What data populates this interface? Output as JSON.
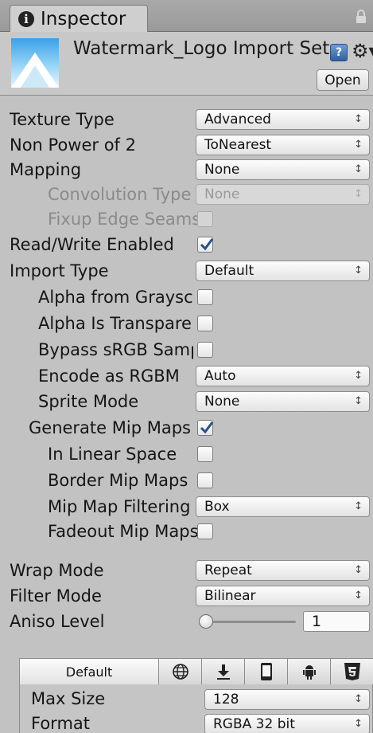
{
  "tab": {
    "title": "Inspector",
    "info_icon": "info-icon",
    "lock_icon": "lock-icon"
  },
  "header": {
    "title": "Watermark_Logo Import Settin",
    "open_label": "Open",
    "help_icon": "?",
    "gear_icon": "⚙▾"
  },
  "properties": {
    "texture_type": {
      "label": "Texture Type",
      "value": "Advanced"
    },
    "non_power_of_2": {
      "label": "Non Power of 2",
      "value": "ToNearest"
    },
    "mapping": {
      "label": "Mapping",
      "value": "None"
    },
    "convolution_type": {
      "label": "Convolution Type",
      "value": "None",
      "disabled": true
    },
    "fixup_edge_seams": {
      "label": "Fixup Edge Seams",
      "checked": false,
      "disabled": true
    },
    "read_write_enabled": {
      "label": "Read/Write Enabled",
      "checked": true
    },
    "import_type": {
      "label": "Import Type",
      "value": "Default"
    },
    "alpha_from_grayscale": {
      "label": "Alpha from Graysca",
      "checked": false
    },
    "alpha_is_transparency": {
      "label": "Alpha Is Transpare",
      "checked": false
    },
    "bypass_srgb": {
      "label": "Bypass sRGB Sampl",
      "checked": false
    },
    "encode_as_rgbm": {
      "label": "Encode as RGBM",
      "value": "Auto"
    },
    "sprite_mode": {
      "label": "Sprite Mode",
      "value": "None"
    },
    "generate_mip_maps": {
      "label": "Generate Mip Maps",
      "checked": true
    },
    "in_linear_space": {
      "label": "In Linear Space",
      "checked": false
    },
    "border_mip_maps": {
      "label": "Border Mip Maps",
      "checked": false
    },
    "mip_map_filtering": {
      "label": "Mip Map Filtering",
      "value": "Box"
    },
    "fadeout_mip_maps": {
      "label": "Fadeout Mip Maps",
      "checked": false
    },
    "wrap_mode": {
      "label": "Wrap Mode",
      "value": "Repeat"
    },
    "filter_mode": {
      "label": "Filter Mode",
      "value": "Bilinear"
    },
    "aniso_level": {
      "label": "Aniso Level",
      "value": "1",
      "slider_fraction": 0.0
    }
  },
  "platform": {
    "tabs": [
      {
        "label": "Default"
      },
      {
        "icon": "web-globe-icon"
      },
      {
        "icon": "standalone-download-icon"
      },
      {
        "icon": "ios-device-icon"
      },
      {
        "icon": "android-icon"
      },
      {
        "icon": "html5-icon"
      }
    ],
    "max_size": {
      "label": "Max Size",
      "value": "128"
    },
    "format": {
      "label": "Format",
      "value": "RGBA 32 bit"
    }
  },
  "arrows": "↕",
  "colors": {
    "check": "#2c4f86",
    "panel": "#c2c2c2",
    "tab_bar": "#9a9a9a"
  }
}
